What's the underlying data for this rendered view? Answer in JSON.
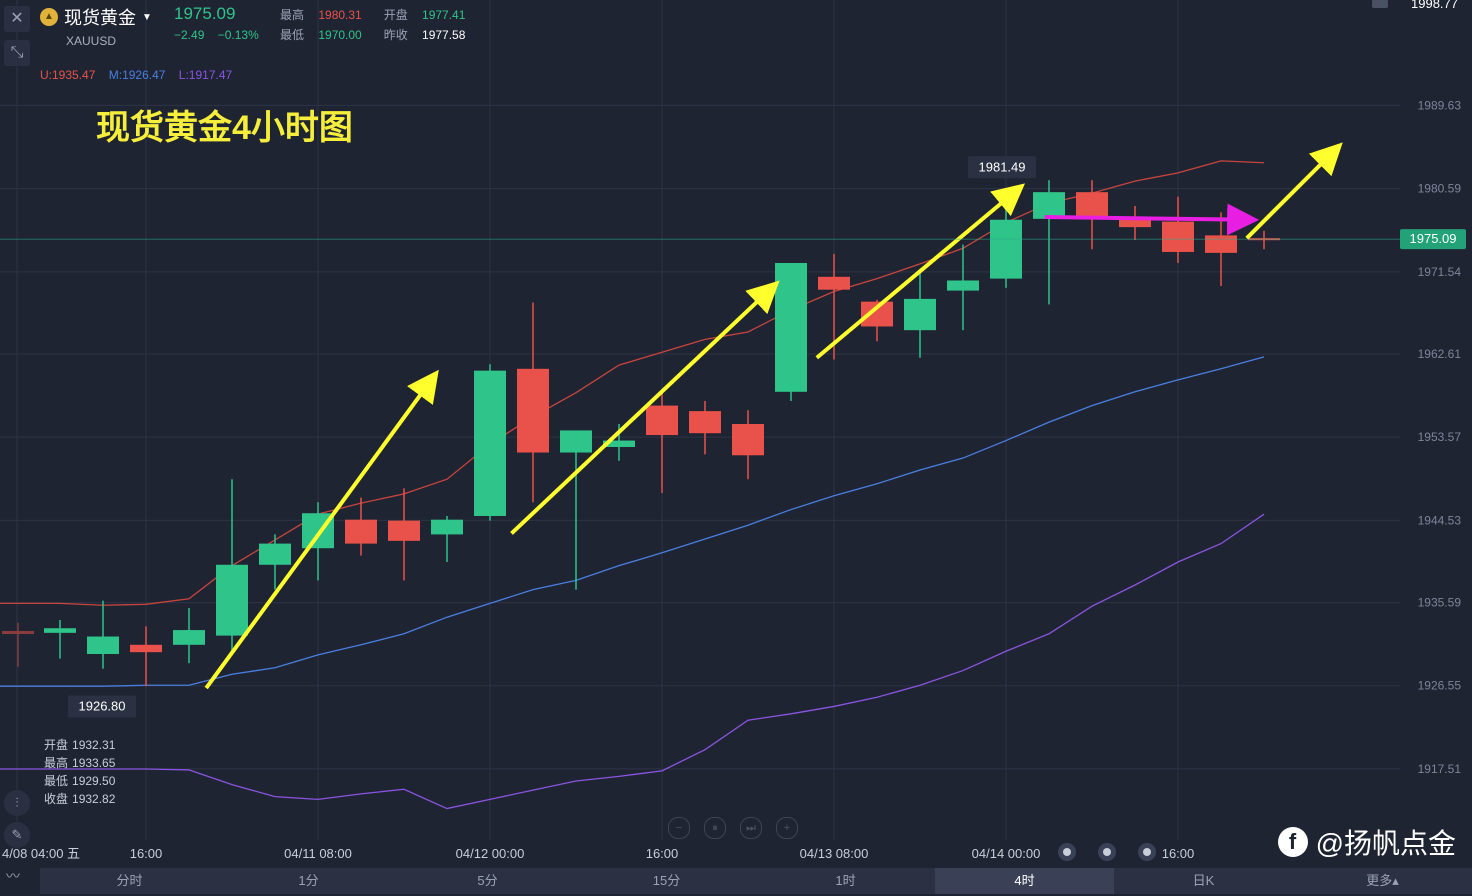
{
  "header": {
    "symbol_name": "现货黄金",
    "symbol_code": "XAUUSD",
    "last_price": "1975.09",
    "change": "−2.49",
    "change_pct": "−0.13%",
    "stats": {
      "high_label": "最高",
      "high": "1980.31",
      "open_label": "开盘",
      "open": "1977.41",
      "low_label": "最低",
      "low": "1970.00",
      "prev_close_label": "昨收",
      "prev_close": "1977.58"
    },
    "top_right_value": "1998.77"
  },
  "bands": {
    "upper": "U:1935.47",
    "middle": "M:1926.47",
    "lower": "L:1917.47"
  },
  "title": "现货黄金4小时图",
  "ohlc_box": {
    "open_label": "开盘",
    "open": "1932.31",
    "high_label": "最高",
    "high": "1933.65",
    "low_label": "最低",
    "low": "1929.50",
    "close_label": "收盘",
    "close": "1932.82"
  },
  "bottom_tabs": [
    "分时",
    "1分",
    "5分",
    "15分",
    "1时",
    "4时",
    "日K",
    "更多▴"
  ],
  "active_tab": "4时",
  "watermark": "@扬帆点金",
  "colors": {
    "up": "#2fc48a",
    "down": "#e9524a",
    "arrow": "#ffff2e",
    "flat_arrow": "#e91ee3",
    "band_upper": "#c8453d",
    "band_middle": "#4a7fe0",
    "band_lower": "#8a55e0"
  },
  "chart_data": {
    "type": "candlestick",
    "title": "现货黄金4小时图",
    "y_range": [
      1910,
      2000
    ],
    "y_ticks": [
      "1989.63",
      "1980.59",
      "1971.54",
      "1962.61",
      "1953.57",
      "1944.53",
      "1935.59",
      "1926.55",
      "1917.51"
    ],
    "current_price_label": "1975.09",
    "x_ticks": [
      "4/08 04:00 五",
      "16:00",
      "04/11 08:00",
      "04/12 00:00",
      "16:00",
      "04/13 08:00",
      "04/14 00:00",
      "16:00"
    ],
    "candles": [
      {
        "o": 1932.3,
        "h": 1933.7,
        "l": 1929.5,
        "c": 1932.8
      },
      {
        "o": 1930.0,
        "h": 1935.8,
        "l": 1928.4,
        "c": 1931.9
      },
      {
        "o": 1931.0,
        "h": 1933.0,
        "l": 1926.5,
        "c": 1930.2
      },
      {
        "o": 1931.0,
        "h": 1935.0,
        "l": 1929.0,
        "c": 1932.6
      },
      {
        "o": 1932.0,
        "h": 1949.0,
        "l": 1930.0,
        "c": 1939.7
      },
      {
        "o": 1939.7,
        "h": 1943.0,
        "l": 1937.0,
        "c": 1942.0
      },
      {
        "o": 1941.5,
        "h": 1946.5,
        "l": 1938.0,
        "c": 1945.3
      },
      {
        "o": 1944.6,
        "h": 1947.0,
        "l": 1940.7,
        "c": 1942.0
      },
      {
        "o": 1944.5,
        "h": 1948.0,
        "l": 1938.0,
        "c": 1942.3
      },
      {
        "o": 1943.0,
        "h": 1945.0,
        "l": 1940.0,
        "c": 1944.6
      },
      {
        "o": 1945.0,
        "h": 1961.5,
        "l": 1944.5,
        "c": 1960.8
      },
      {
        "o": 1961.0,
        "h": 1968.2,
        "l": 1946.5,
        "c": 1951.9
      },
      {
        "o": 1951.9,
        "h": 1953.0,
        "l": 1937.0,
        "c": 1954.3
      },
      {
        "o": 1952.5,
        "h": 1955.0,
        "l": 1951.0,
        "c": 1953.2
      },
      {
        "o": 1957.0,
        "h": 1958.5,
        "l": 1947.5,
        "c": 1953.8
      },
      {
        "o": 1956.4,
        "h": 1957.5,
        "l": 1951.7,
        "c": 1954.0
      },
      {
        "o": 1955.0,
        "h": 1956.5,
        "l": 1949.0,
        "c": 1951.6
      },
      {
        "o": 1958.5,
        "h": 1969.5,
        "l": 1957.5,
        "c": 1972.5
      },
      {
        "o": 1971.0,
        "h": 1973.5,
        "l": 1962.0,
        "c": 1969.6
      },
      {
        "o": 1968.3,
        "h": 1968.5,
        "l": 1964.0,
        "c": 1965.6
      },
      {
        "o": 1965.2,
        "h": 1971.5,
        "l": 1962.2,
        "c": 1968.6
      },
      {
        "o": 1969.5,
        "h": 1974.5,
        "l": 1965.2,
        "c": 1970.6
      },
      {
        "o": 1970.8,
        "h": 1980.0,
        "l": 1969.8,
        "c": 1977.2
      },
      {
        "o": 1977.3,
        "h": 1981.5,
        "l": 1968.0,
        "c": 1980.2
      },
      {
        "o": 1980.2,
        "h": 1981.5,
        "l": 1974.0,
        "c": 1977.5
      },
      {
        "o": 1977.5,
        "h": 1978.7,
        "l": 1975.0,
        "c": 1976.4
      },
      {
        "o": 1977.0,
        "h": 1979.7,
        "l": 1972.5,
        "c": 1973.7
      },
      {
        "o": 1975.5,
        "h": 1978.0,
        "l": 1970.0,
        "c": 1973.6
      },
      {
        "o": 1975.2,
        "h": 1976.0,
        "l": 1974.0,
        "c": 1975.1
      }
    ],
    "series": [
      {
        "values": [
          1935.5,
          1935.3,
          1935.4,
          1936.0,
          1939.6,
          1942.4,
          1945.2,
          1946.4,
          1947.4,
          1949.0,
          1952.8,
          1955.8,
          1958.4,
          1961.4,
          1962.8,
          1964.2,
          1965.0,
          1967.4,
          1969.4,
          1970.8,
          1972.4,
          1974.1,
          1976.9,
          1979.0,
          1980.1,
          1981.4,
          1982.3,
          1983.6,
          1983.4
        ]
      },
      {
        "values": [
          1926.5,
          1926.5,
          1926.6,
          1926.6,
          1927.8,
          1928.5,
          1929.9,
          1931.0,
          1932.2,
          1934.0,
          1935.5,
          1937.0,
          1938.0,
          1939.6,
          1941.0,
          1942.5,
          1944.0,
          1945.7,
          1947.2,
          1948.5,
          1950.0,
          1951.3,
          1953.2,
          1955.2,
          1957.0,
          1958.5,
          1959.8,
          1961.0,
          1962.3
        ]
      },
      {
        "values": [
          1917.5,
          1917.5,
          1917.5,
          1917.4,
          1915.8,
          1914.5,
          1914.2,
          1914.8,
          1915.3,
          1913.2,
          1914.2,
          1915.2,
          1916.2,
          1916.7,
          1917.3,
          1919.6,
          1922.8,
          1923.5,
          1924.3,
          1925.3,
          1926.6,
          1928.2,
          1930.3,
          1932.2,
          1935.2,
          1937.5,
          1940.0,
          1942.0,
          1945.2
        ]
      }
    ],
    "highlights": {
      "max_label": "1981.49",
      "min_label": "1926.80"
    },
    "annotations": [
      {
        "kind": "arrow",
        "color": "#ffff2e",
        "from": [
          3.4,
          1926.3
        ],
        "to": [
          8.7,
          1960.2
        ]
      },
      {
        "kind": "arrow",
        "color": "#ffff2e",
        "from": [
          10.5,
          1943.1
        ],
        "to": [
          16.6,
          1970.0
        ]
      },
      {
        "kind": "arrow",
        "color": "#ffff2e",
        "from": [
          17.6,
          1962.2
        ],
        "to": [
          22.3,
          1980.6
        ]
      },
      {
        "kind": "arrow",
        "color": "#e91ee3",
        "from": [
          22.9,
          1977.5
        ],
        "to": [
          27.7,
          1977.2
        ]
      },
      {
        "kind": "arrow",
        "color": "#ffff2e",
        "from": [
          27.6,
          1975.2
        ],
        "to": [
          29.7,
          1985.0
        ]
      }
    ]
  }
}
